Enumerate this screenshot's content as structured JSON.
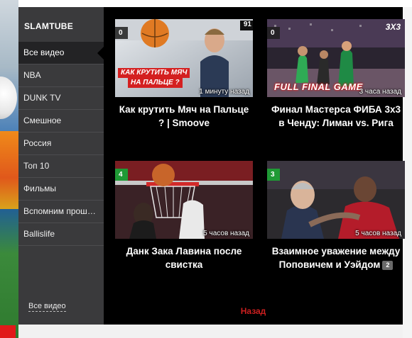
{
  "sidebar": {
    "title": "SLAMTUBE",
    "items": [
      {
        "label": "Все видео",
        "active": true
      },
      {
        "label": "NBA"
      },
      {
        "label": "DUNK TV"
      },
      {
        "label": "Смешное"
      },
      {
        "label": "Россия"
      },
      {
        "label": "Топ 10"
      },
      {
        "label": "Фильмы"
      },
      {
        "label": "Вспомним прошлое"
      },
      {
        "label": "Ballislife"
      }
    ],
    "footer_link": "Все видео"
  },
  "videos": [
    {
      "badge": "0",
      "badge_color": "#2a2a2a",
      "time": "1 минуту назад",
      "title": "Как крутить Мяч на Пальце ? | Smoove",
      "thumb_text_1": "КАК КРУТИТЬ МЯЧ",
      "thumb_text_2": "НА ПАЛЬЦЕ ?",
      "thumb_number": "91"
    },
    {
      "badge": "0",
      "badge_color": "#2a2a2a",
      "time": "3 часа назад",
      "title": "Финал Мастерса ФИБА 3х3 в Ченду: Лиман vs. Рига",
      "thumb_text_1": "FULL FINAL GAME",
      "thumb_logo": "3X3"
    },
    {
      "badge": "4",
      "badge_color": "#1f9a35",
      "time": "5 часов назад",
      "title": "Данк Зака Лавина после свистка"
    },
    {
      "badge": "3",
      "badge_color": "#1f9a35",
      "time": "5 часов назад",
      "title": "Взаимное уважение между Поповичем и Уэйдом",
      "comments": "2"
    }
  ],
  "back_label": "Назад"
}
